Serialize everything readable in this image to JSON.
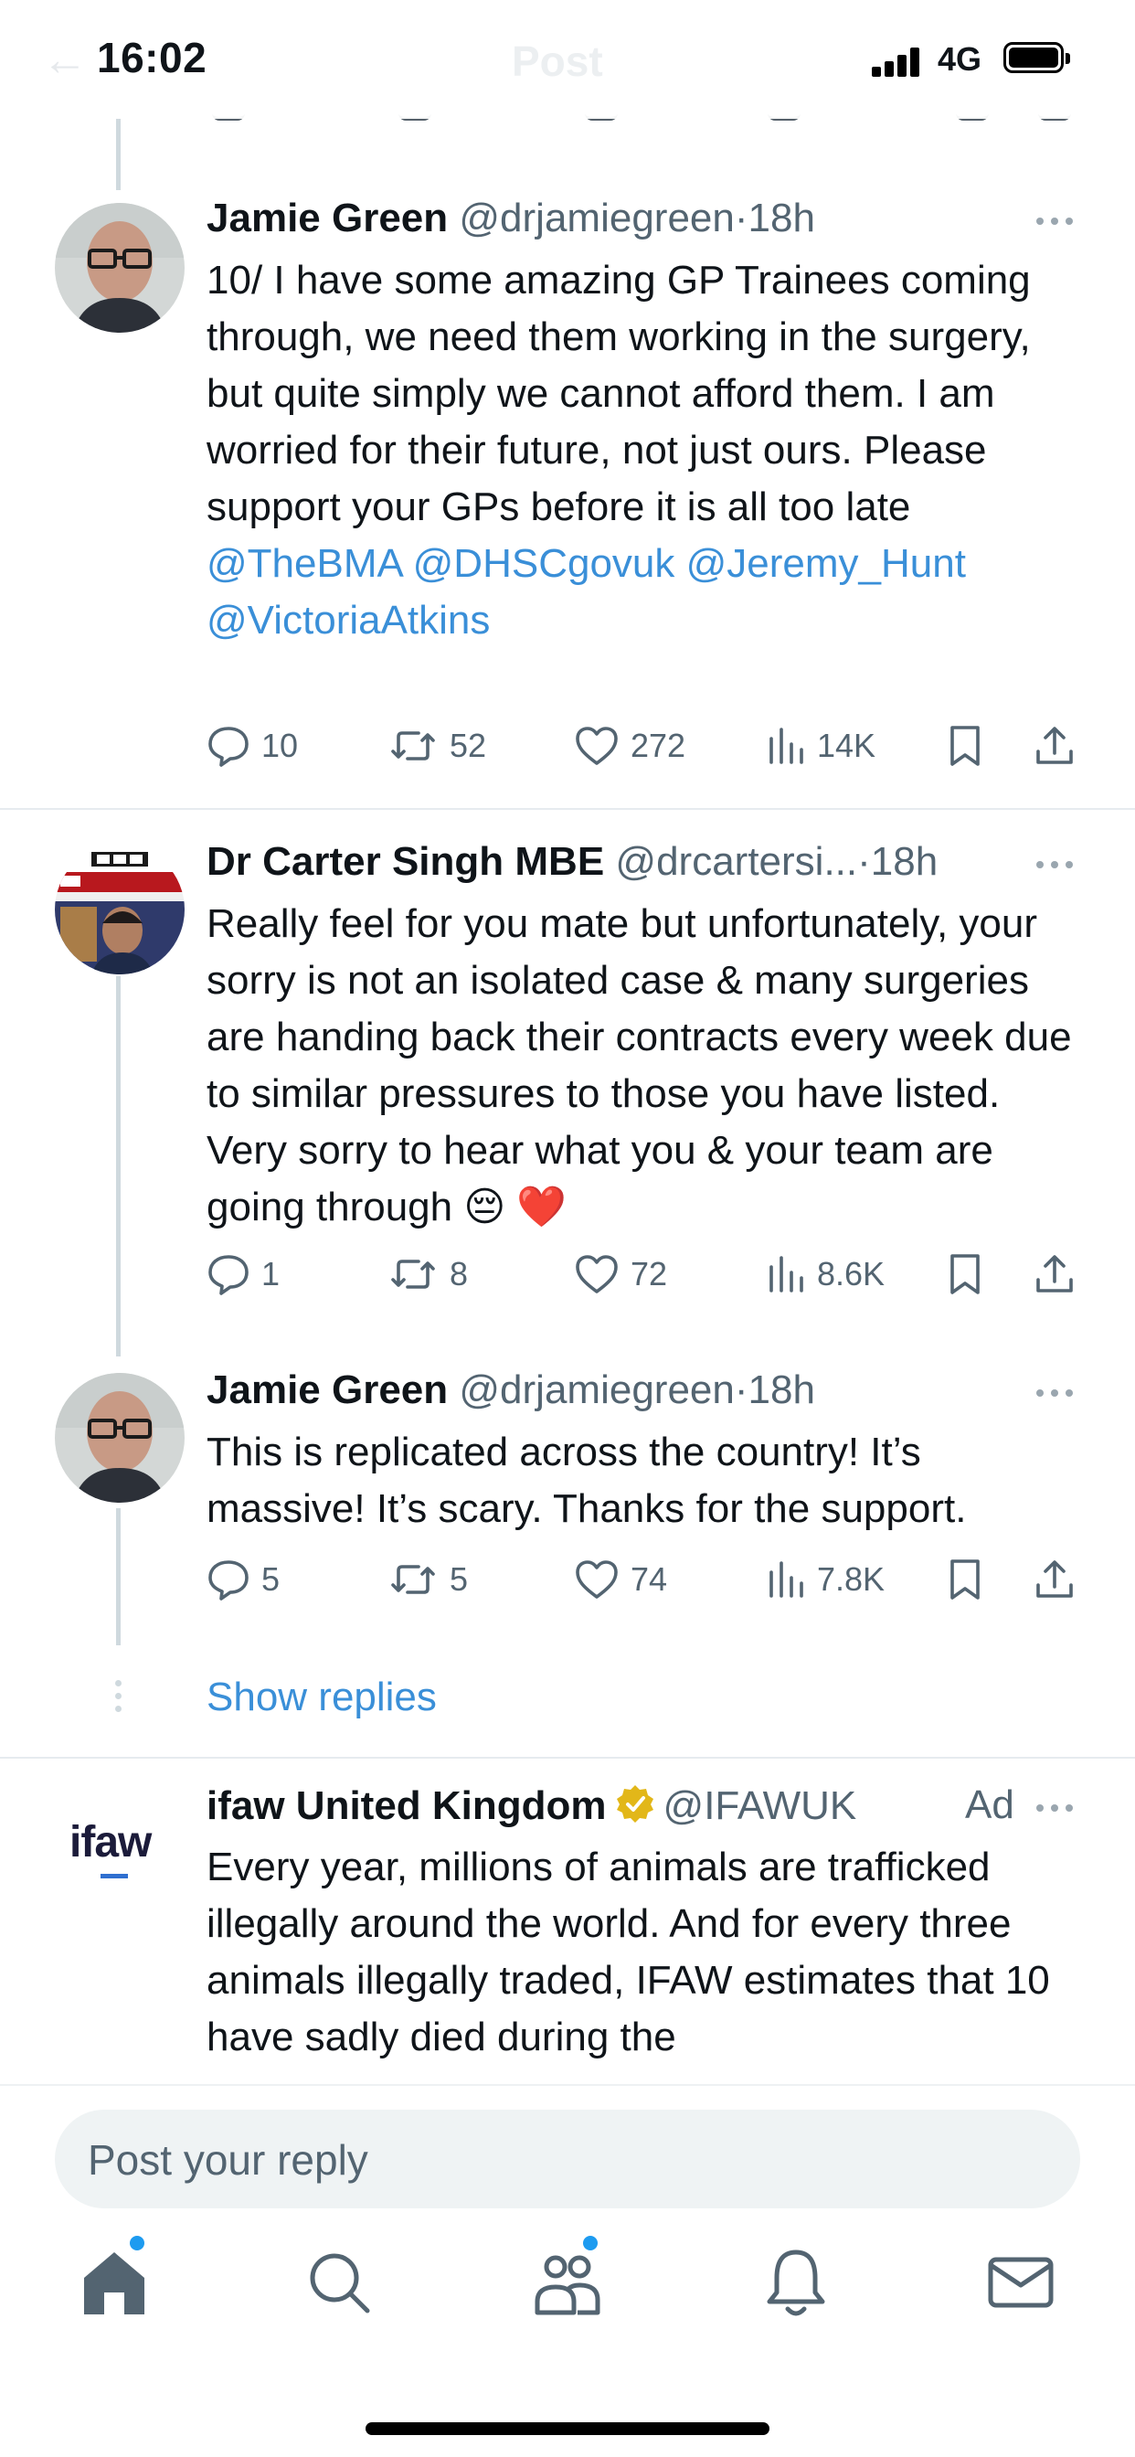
{
  "status_bar": {
    "time": "16:02",
    "network": "4G",
    "ghost_title": "Post"
  },
  "tweets": [
    {
      "name": "Jamie Green",
      "handle": "@drjamiegreen",
      "dot": "·",
      "time": "18h",
      "text_plain": "10/ I have some amazing GP Trainees coming through, we need them working in the surgery, but quite simply we cannot afford them. I am worried for their future, not just ours.  Please support your GPs before it is all too late ",
      "mentions": [
        "@TheBMA",
        "@DHSCgovuk",
        "@Jeremy_Hunt",
        "@VictoriaAtkins"
      ],
      "replies": "10",
      "reposts": "52",
      "likes": "272",
      "views": "14K"
    },
    {
      "name": "Dr Carter Singh MBE",
      "handle": "@drcartersi...",
      "dot": "·",
      "time": "18h",
      "text": "Really feel for you mate but unfortunately, your sorry is not an isolated case & many surgeries are handing back their contracts every week due to similar pressures to those you have listed. Very sorry to hear what you & your team are going through 😔 ❤️",
      "replies": "1",
      "reposts": "8",
      "likes": "72",
      "views": "8.6K"
    },
    {
      "name": "Jamie Green",
      "handle": "@drjamiegreen",
      "dot": "·",
      "time": "18h",
      "text": "This is replicated across the country! It’s massive! It’s scary. Thanks for the support.",
      "replies": "5",
      "reposts": "5",
      "likes": "74",
      "views": "7.8K"
    }
  ],
  "show_replies": "Show replies",
  "ad": {
    "logo": "ifaw",
    "name": "ifaw United Kingdom",
    "handle": "@IFAWUK",
    "label": "Ad",
    "text": "Every year, millions of animals are trafficked illegally around the world. And for every three animals illegally traded, IFAW estimates that 10 have sadly died during the"
  },
  "reply_box": {
    "placeholder": "Post your reply"
  },
  "tabbar": [
    "home-icon",
    "search-icon",
    "communities-icon",
    "notifications-icon",
    "messages-icon"
  ],
  "colors": {
    "link": "#1d9bf0",
    "muted": "#536471",
    "text": "#0f1419",
    "verified": "#e2b719"
  }
}
